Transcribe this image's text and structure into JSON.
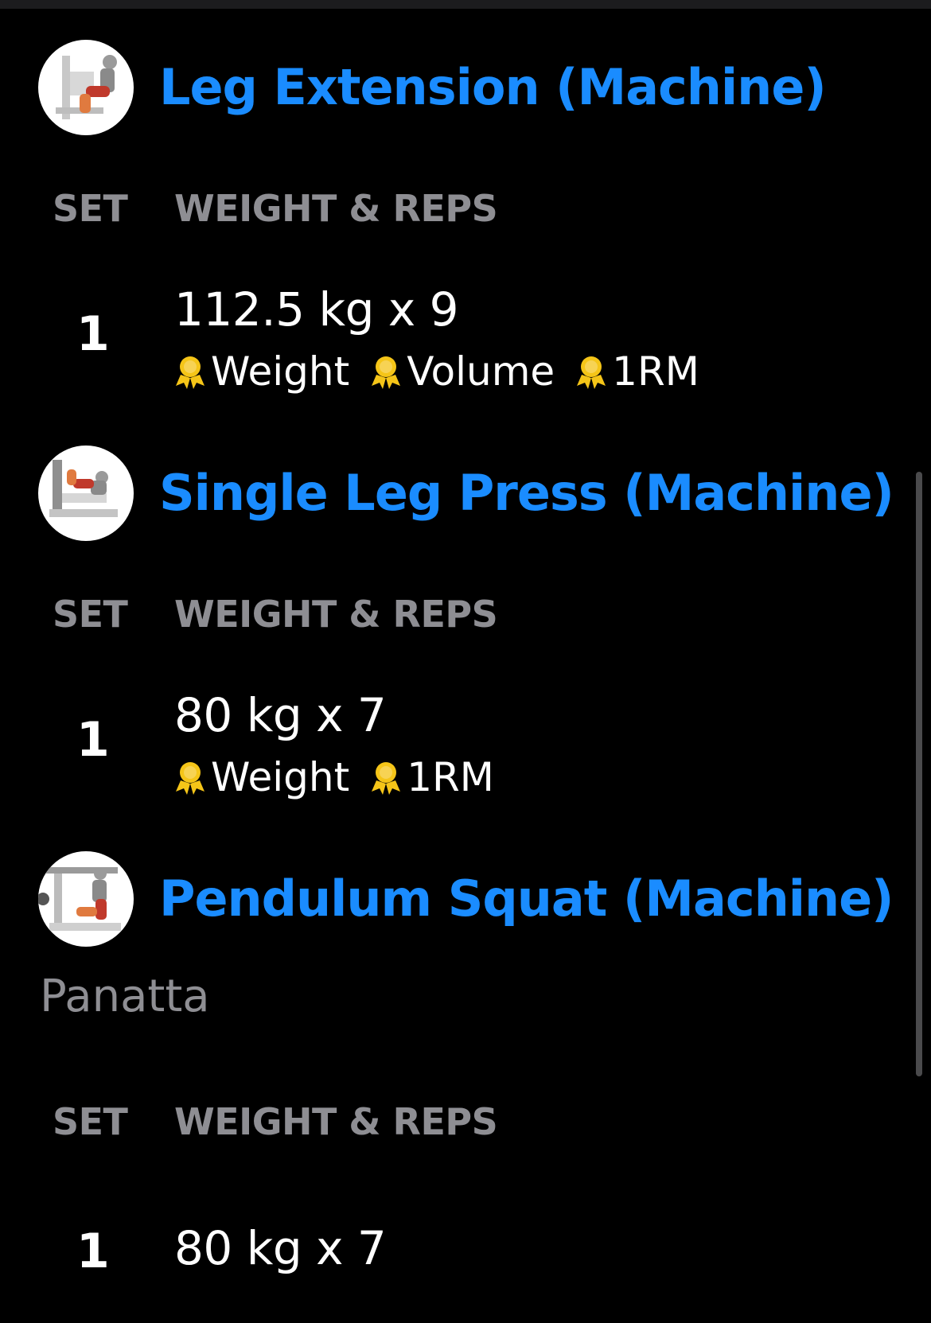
{
  "colors": {
    "accent": "#1a8cff",
    "background": "#000000",
    "muted": "#8e8e93",
    "medal": "#f5c518"
  },
  "exercises": [
    {
      "title": "Leg Extension (Machine)",
      "thumb_icon": "leg-extension-machine-illustration",
      "columns": {
        "set": "SET",
        "weight_reps": "WEIGHT & REPS"
      },
      "sets": [
        {
          "number": "1",
          "value": "112.5 kg x 9",
          "records": [
            "Weight",
            "Volume",
            "1RM"
          ]
        }
      ]
    },
    {
      "title": "Single Leg Press (Machine)",
      "thumb_icon": "leg-press-machine-illustration",
      "columns": {
        "set": "SET",
        "weight_reps": "WEIGHT & REPS"
      },
      "sets": [
        {
          "number": "1",
          "value": "80 kg x 7",
          "records": [
            "Weight",
            "1RM"
          ]
        }
      ]
    },
    {
      "title": "Pendulum Squat (Machine)",
      "thumb_icon": "pendulum-squat-machine-illustration",
      "note": "Panatta",
      "columns": {
        "set": "SET",
        "weight_reps": "WEIGHT & REPS"
      },
      "sets": [
        {
          "number": "1",
          "value": "80 kg x 7",
          "records": []
        }
      ]
    }
  ]
}
